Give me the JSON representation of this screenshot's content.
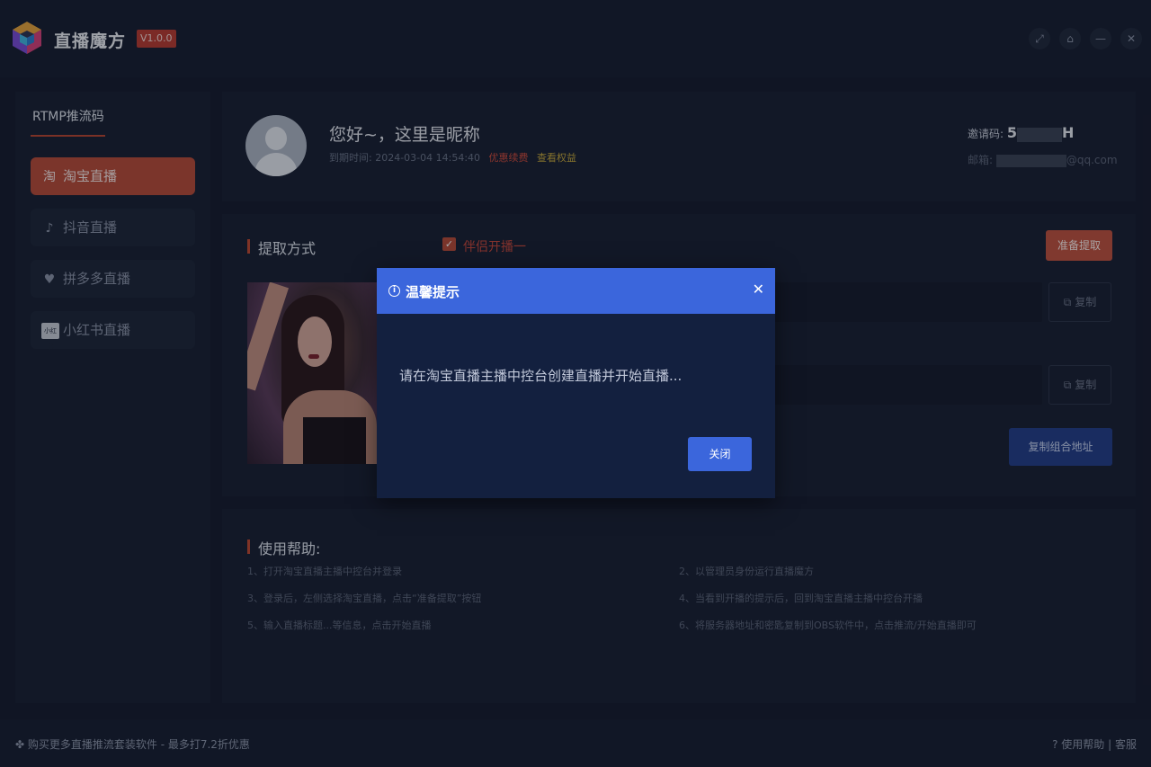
{
  "app": {
    "title": "直播魔方",
    "version": "V1.0.0",
    "window_controls": [
      "fullscreen-icon",
      "pin-icon",
      "minimize-icon",
      "close-icon"
    ],
    "window_control_glyphs": [
      "⤢",
      "⌂",
      "—",
      "✕"
    ]
  },
  "sidebar": {
    "heading": "RTMP推流码",
    "items": [
      {
        "label": "淘宝直播",
        "icon": "taobao-icon",
        "glyph": "淘",
        "active": true
      },
      {
        "label": "抖音直播",
        "icon": "douyin-icon",
        "glyph": "♪",
        "active": false
      },
      {
        "label": "拼多多直播",
        "icon": "pinduoduo-icon",
        "glyph": "♥",
        "active": false
      },
      {
        "label": "小红书直播",
        "icon": "xiaohongshu-icon",
        "glyph": "小红书",
        "active": false
      }
    ]
  },
  "profile": {
    "greeting": "您好~，这里是昵称",
    "expire_label": "到期时间:",
    "expire_time": "2024-03-04 14:54:40",
    "renew_link": "优惠续费",
    "rights_link": "查看权益",
    "invite_label": "邀请码:",
    "invite_code_start": "5",
    "invite_code_end": "H",
    "email_label": "邮箱:",
    "email_suffix": "@qq.com"
  },
  "extract": {
    "title": "提取方式",
    "checkbox_label": "伴侣开播一",
    "checked": true,
    "prepare_button": "准备提取",
    "copy_button_1": "复制",
    "copy_button_2": "复制",
    "copy_combo_button": "复制组合地址"
  },
  "help": {
    "title": "使用帮助:",
    "items": [
      "1、打开淘宝直播主播中控台并登录",
      "2、以管理员身份运行直播魔方",
      "3、登录后，左侧选择淘宝直播，点击“准备提取”按钮",
      "4、当看到开播的提示后，回到淘宝直播主播中控台开播",
      "5、输入直播标题...等信息，点击开始直播",
      "6、将服务器地址和密匙复制到OBS软件中，点击推流/开始直播即可"
    ]
  },
  "footer": {
    "left_text": "购买更多直播推流套装软件 - 最多打7.2折优惠",
    "help_link": "使用帮助",
    "separator": "|",
    "service_link": "客服"
  },
  "dialog": {
    "title": "温馨提示",
    "message": "请在淘宝直播主播中控台创建直播并开始直播...",
    "close_button": "关闭"
  },
  "colors": {
    "background": "#141a2b",
    "panel": "#181e30",
    "accent_red": "#b84a37",
    "dialog_blue": "#3b66dc",
    "dialog_body": "#13203f"
  }
}
